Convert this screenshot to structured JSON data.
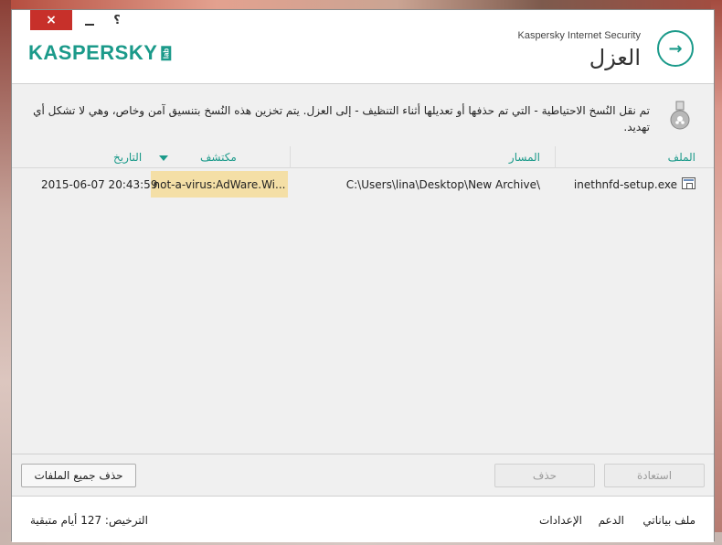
{
  "window": {
    "close_symbol": "×",
    "help_symbol": "؟"
  },
  "header": {
    "logo_text": "KASPERSKY",
    "logo_lab": "lab",
    "app_name": "Kaspersky Internet Security",
    "title": "العزل",
    "back_symbol": "→"
  },
  "info": {
    "icon": "quarantine-flask-icon",
    "text": "تم نقل النُسخ الاحتياطية - التي تم حذفها أو تعديلها أثناء التنظيف - إلى العزل. يتم تخزين هذه النُسخ بتنسيق آمن وخاص، وهي لا تشكل أي تهديد."
  },
  "table": {
    "columns": {
      "file": "الملف",
      "path": "المسار",
      "detected": "مكتشف",
      "date": "التاريخ"
    },
    "rows": [
      {
        "file": "inethnfd-setup.exe",
        "path": "C:\\Users\\lina\\Desktop\\New Archive\\",
        "detected": "not-a-virus:AdWare.Wi...",
        "date": "2015-06-07 20:43:59"
      }
    ]
  },
  "buttons": {
    "restore": "استعادة",
    "delete": "حذف",
    "delete_all": "حذف جميع الملفات"
  },
  "footer": {
    "my_profile": "ملف بياناتي",
    "support": "الدعم",
    "settings": "الإعدادات",
    "license": "الترخيص:  127  أيام متبقية"
  },
  "colors": {
    "accent": "#1b9a8a",
    "highlight": "#f4dfa6",
    "close_button": "#c7302a"
  }
}
